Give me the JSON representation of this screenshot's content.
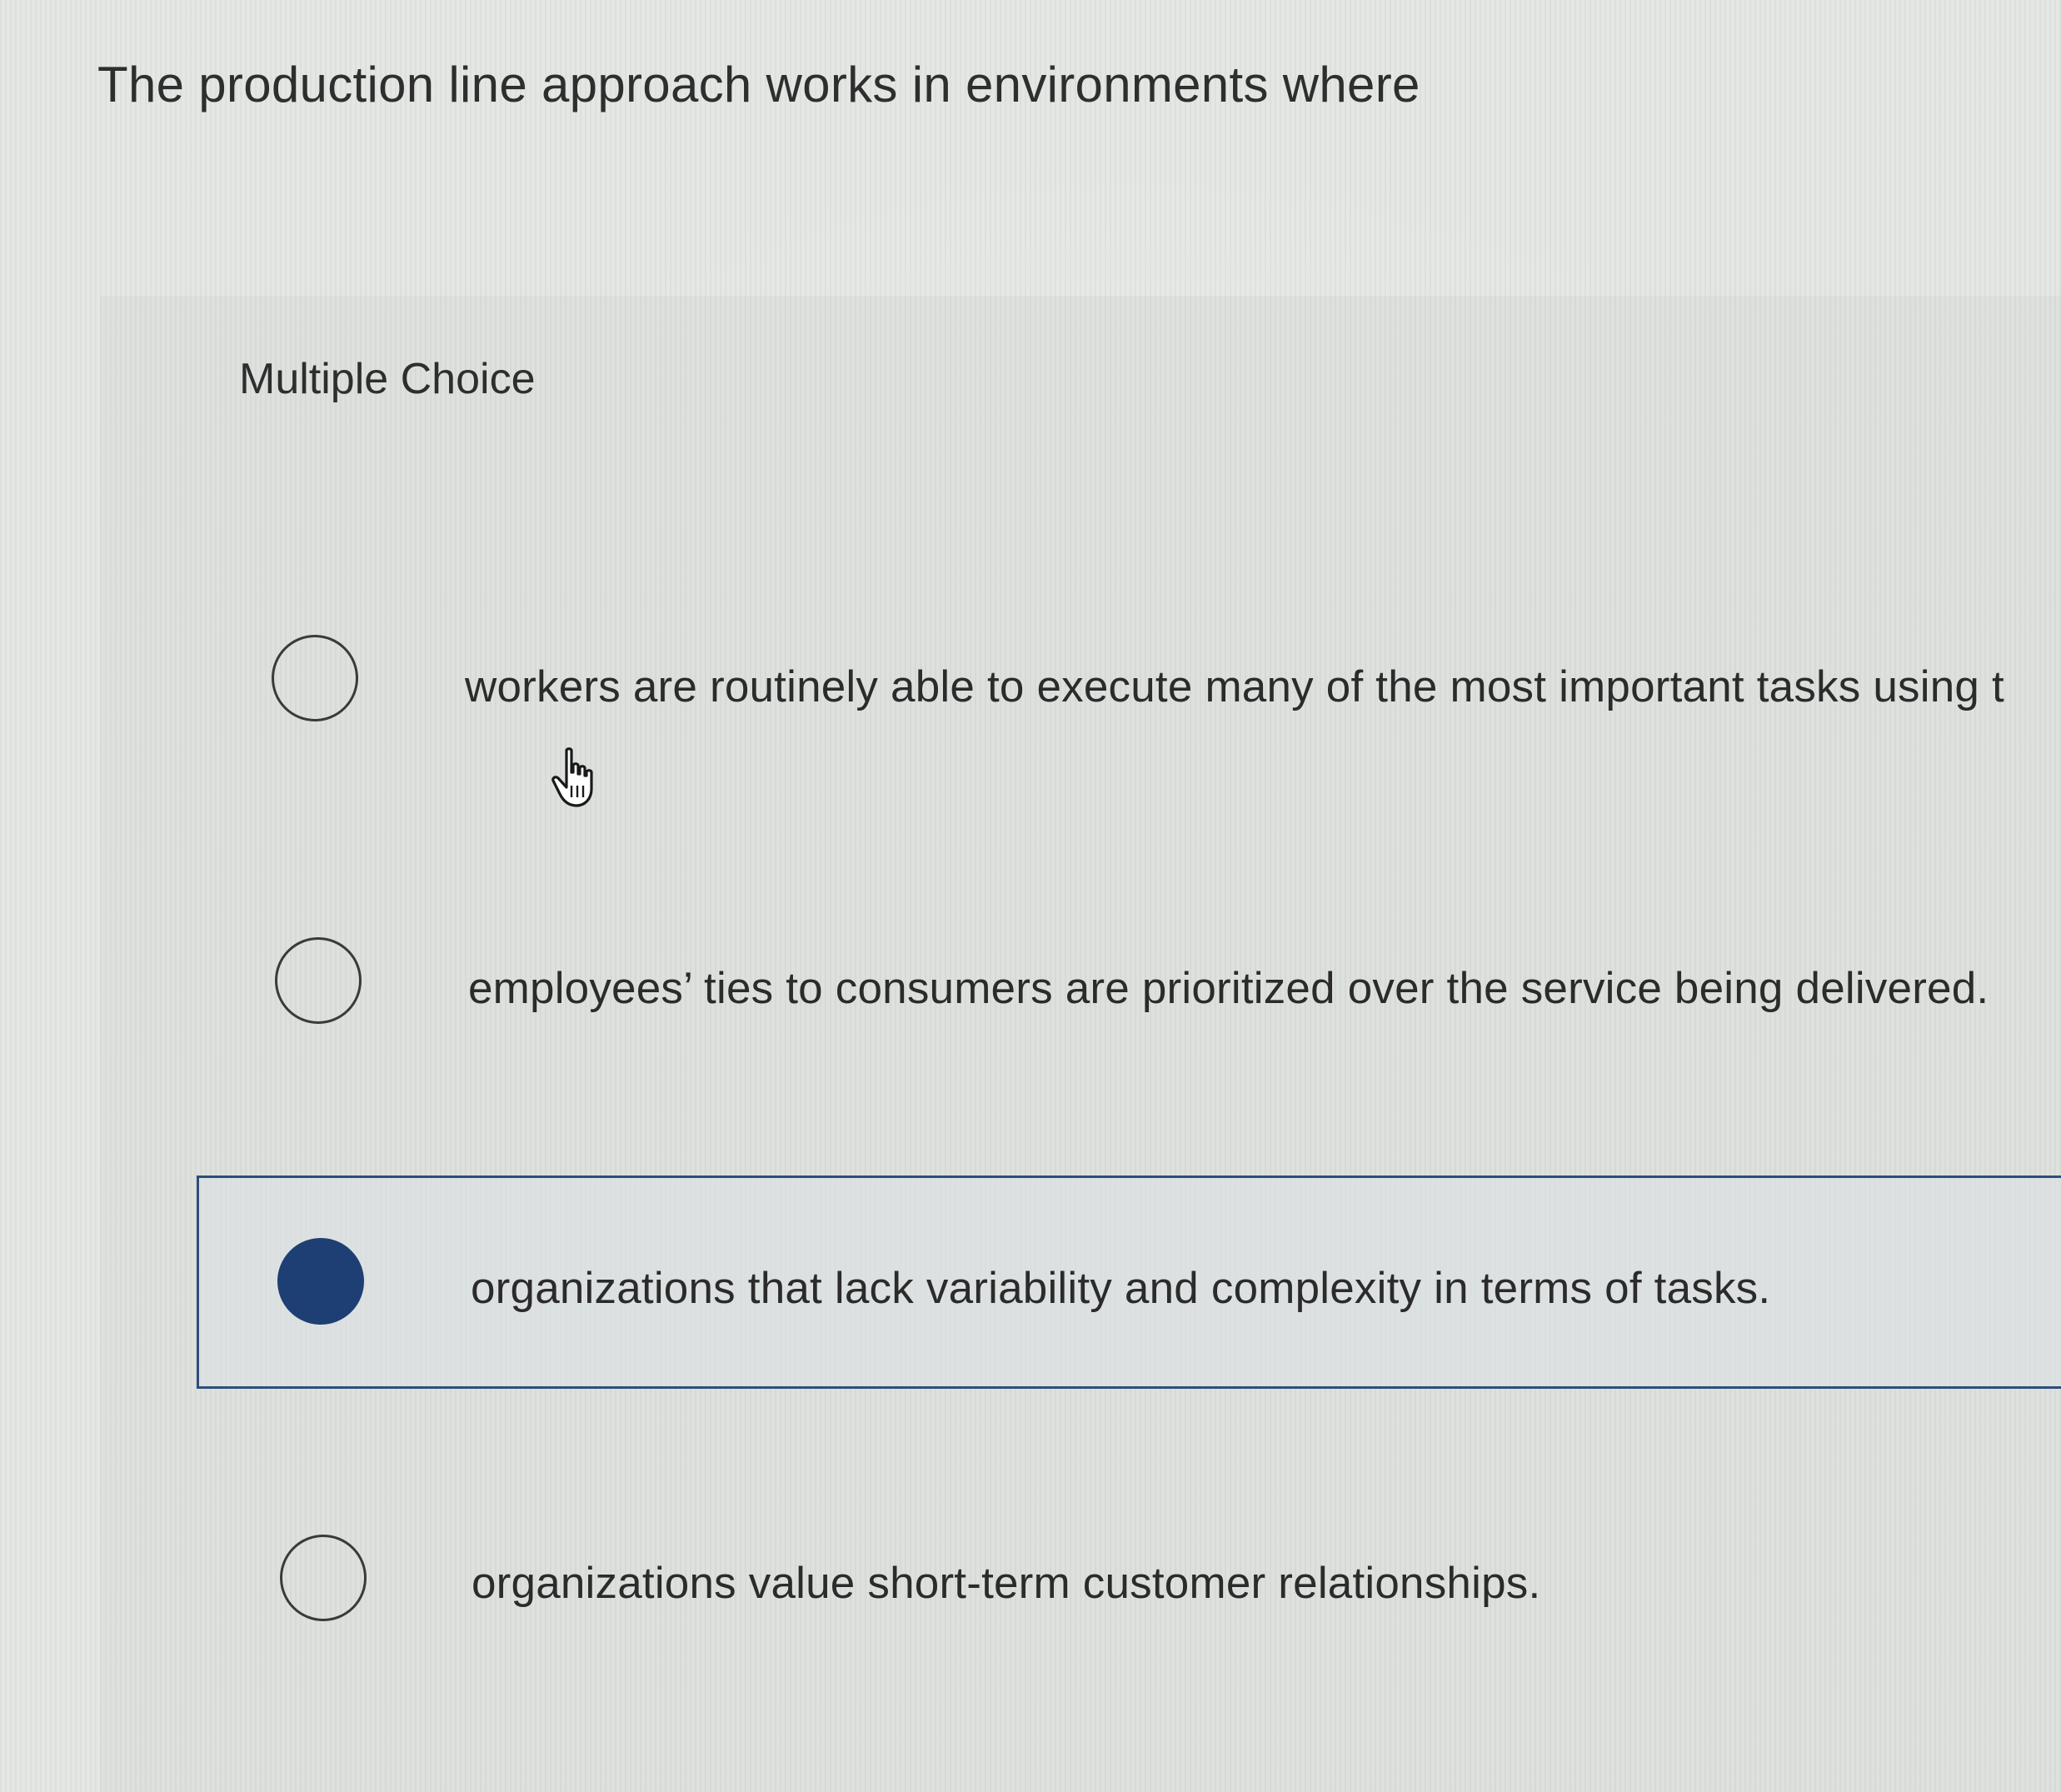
{
  "question": {
    "text": "The production line approach works in environments where"
  },
  "answer_panel": {
    "label": "Multiple Choice",
    "options": [
      {
        "text": "workers are routinely able to execute many of the most important tasks using t",
        "selected": false
      },
      {
        "text": "employees’ ties to consumers are prioritized over the service being delivered.",
        "selected": false
      },
      {
        "text": "organizations that lack variability and complexity in terms of tasks.",
        "selected": true
      },
      {
        "text": "organizations value short-term customer relationships.",
        "selected": false
      }
    ]
  },
  "cursor": {
    "icon": "hand-pointer-icon"
  },
  "colors": {
    "selected_radio": "#1e3f74",
    "selected_border": "#2e4d7a",
    "background": "#e3e6e3"
  }
}
